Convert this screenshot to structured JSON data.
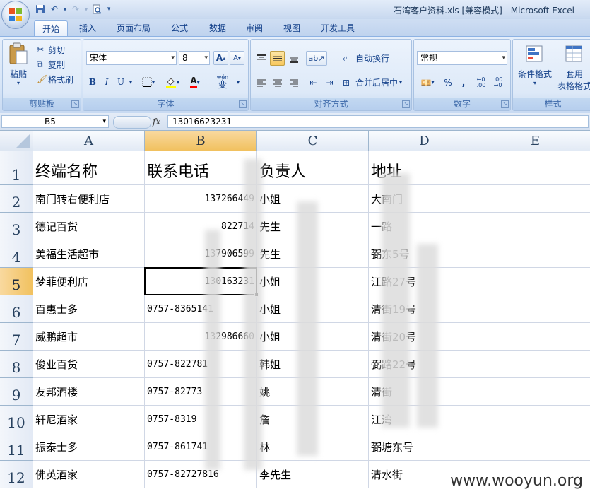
{
  "window": {
    "title": "石湾客户资料.xls  [兼容模式] - Microsoft Excel"
  },
  "tabs": [
    "开始",
    "插入",
    "页面布局",
    "公式",
    "数据",
    "审阅",
    "视图",
    "开发工具"
  ],
  "ribbon": {
    "clipboard": {
      "label": "剪贴板",
      "paste": "粘贴",
      "cut": "剪切",
      "copy": "复制",
      "format_painter": "格式刷"
    },
    "font": {
      "label": "字体",
      "font_name": "宋体",
      "font_size": "8",
      "bold": "B",
      "italic": "I",
      "underline": "U",
      "wen": "wén",
      "zi": "变"
    },
    "alignment": {
      "label": "对齐方式",
      "wrap_text": "自动换行",
      "merge_center": "合并后居中"
    },
    "number": {
      "label": "数字",
      "format": "常规",
      "percent": "%",
      "comma": ","
    },
    "styles": {
      "label": "样式",
      "conditional": "条件格式",
      "table_line1": "套用",
      "table_line2": "表格格式"
    }
  },
  "formula_bar": {
    "name_box": "B5",
    "fx": "fx",
    "value": "13016623231"
  },
  "columns": [
    "A",
    "B",
    "C",
    "D",
    "E"
  ],
  "rows": [
    "1",
    "2",
    "3",
    "4",
    "5",
    "6",
    "7",
    "8",
    "9",
    "10",
    "11",
    "12"
  ],
  "cells": [
    [
      "终端名称",
      "联系电话",
      "负责人",
      "地址"
    ],
    [
      "南门转右便利店",
      "137266449",
      "小姐",
      "大南门"
    ],
    [
      "德记百货",
      "822714",
      "先生",
      "一路"
    ],
    [
      "美福生活超市",
      "137906599",
      "先生",
      "弼东5号"
    ],
    [
      "梦菲便利店",
      "130163231",
      "小姐",
      "江路27号"
    ],
    [
      "百惠士多",
      "0757-8365141",
      "小姐",
      "清街19号"
    ],
    [
      "威鹏超市",
      "132986660",
      "小姐",
      "清街20号"
    ],
    [
      "俊业百货",
      "0757-822781",
      "韩姐",
      "弼路22号"
    ],
    [
      "友邦酒楼",
      "0757-82773",
      "姚",
      "清街"
    ],
    [
      "轩尼酒家",
      "0757-8319",
      "詹",
      "江湾"
    ],
    [
      "振泰士多",
      "0757-861741",
      "林",
      "弼塘东号"
    ],
    [
      "佛英酒家",
      "0757-82727816",
      "李先生",
      "清水街"
    ]
  ],
  "watermark": "www.wooyun.org"
}
